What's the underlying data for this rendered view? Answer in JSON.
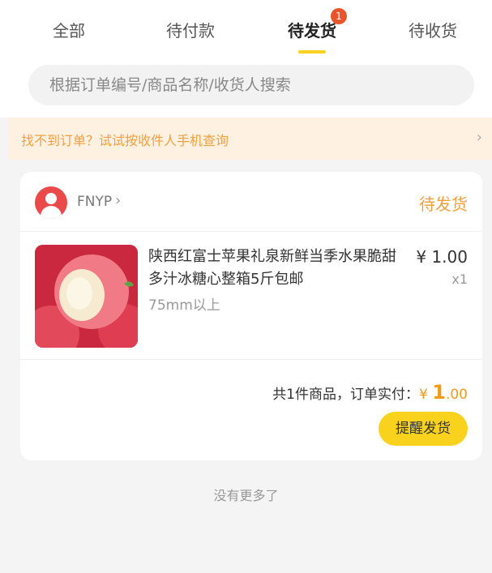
{
  "tabs": [
    {
      "label": "全部"
    },
    {
      "label": "待付款"
    },
    {
      "label": "待发货",
      "badge": "1"
    },
    {
      "label": "待收货"
    }
  ],
  "search": {
    "placeholder": "根据订单编号/商品名称/收货人搜索"
  },
  "notice": {
    "text": "找不到订单？试试按收件人手机查询"
  },
  "order": {
    "shop_name": "FNYP",
    "status": "待发货",
    "item": {
      "title": "陕西红富士苹果礼泉新鲜当季水果脆甜多汁冰糖心整箱5斤包邮",
      "spec": "75mm以上",
      "price": "¥ 1.00",
      "quantity": "x1"
    },
    "summary_label": "共1件商品，订单实付：",
    "total_currency": "¥ ",
    "total_int": "1",
    "total_dec": ".00",
    "action_label": "提醒发货"
  },
  "footer": {
    "text": "没有更多了"
  },
  "colors": {
    "accent": "#f8d21c",
    "status": "#f1a040",
    "badge": "#e8552a"
  }
}
